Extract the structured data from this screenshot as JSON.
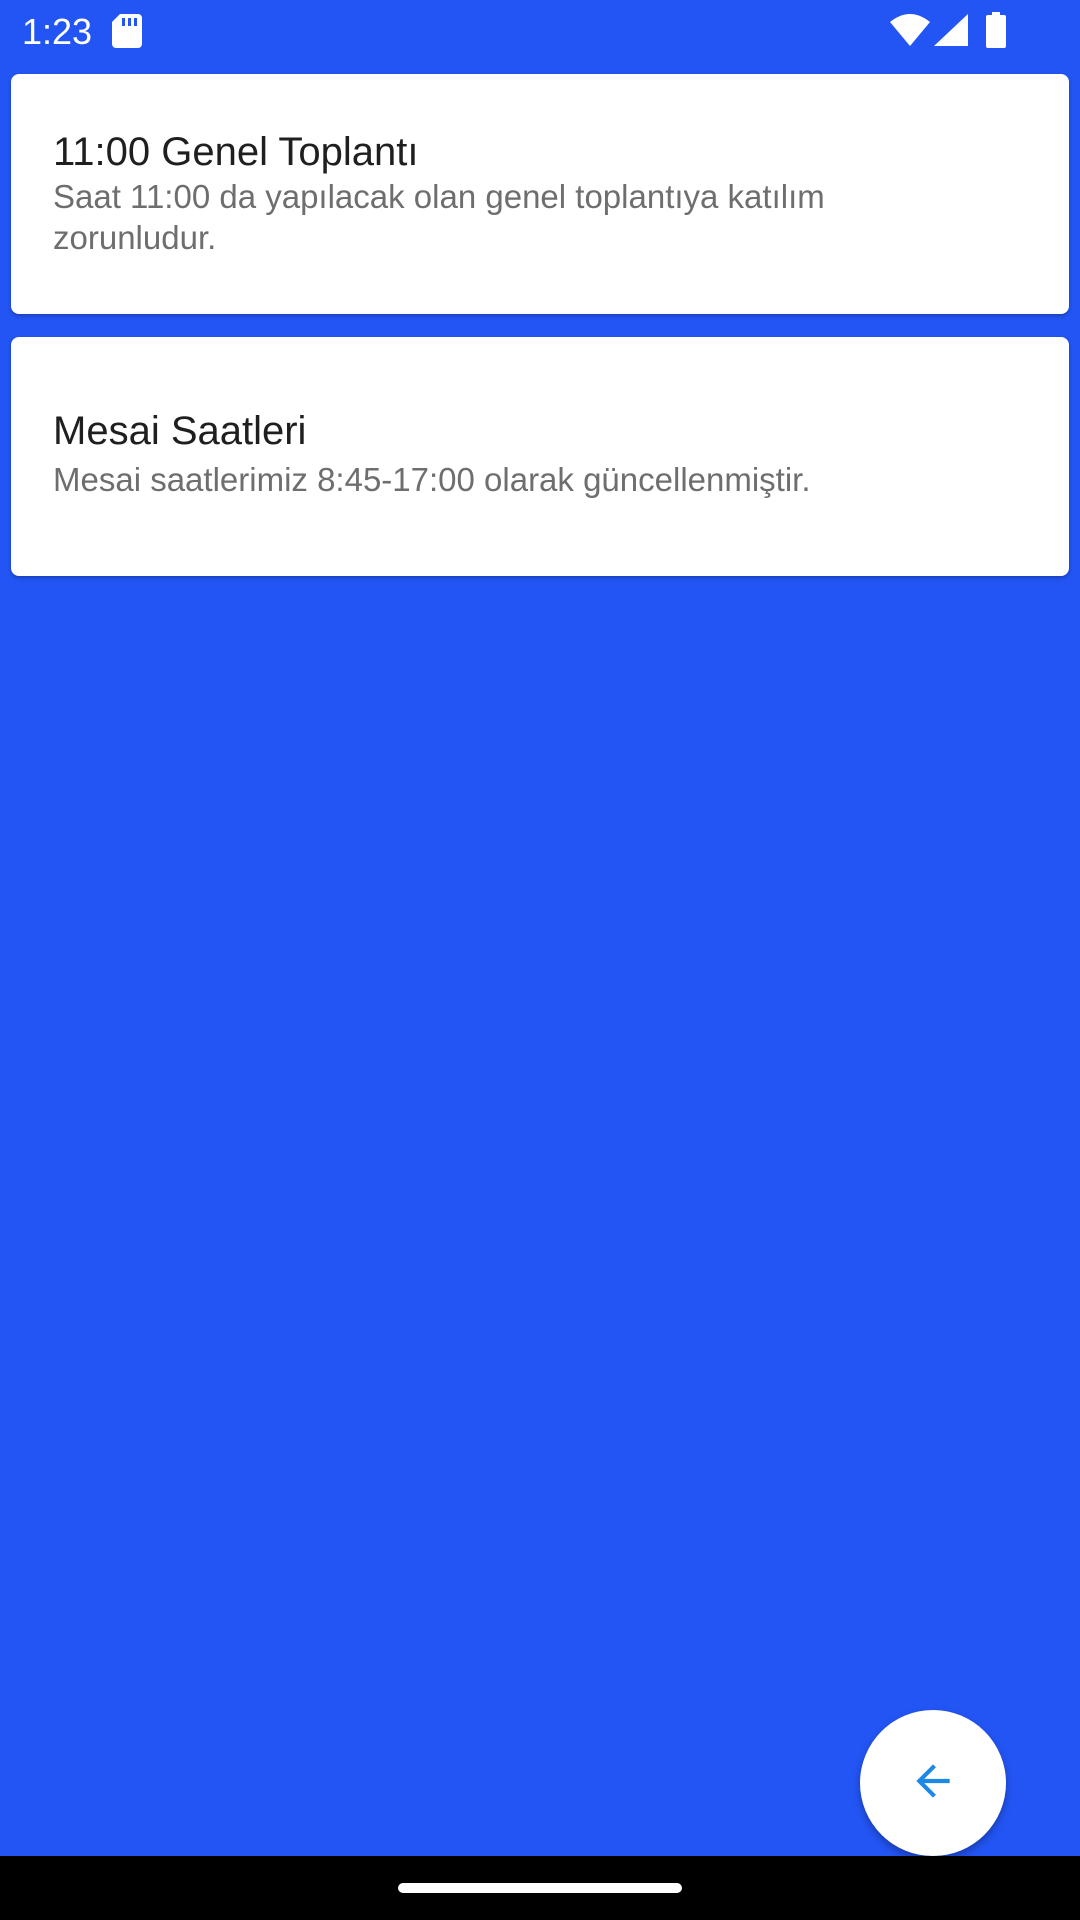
{
  "status_bar": {
    "time": "1:23",
    "icons": [
      "sd-card-icon",
      "wifi-icon",
      "cell-signal-icon",
      "battery-icon"
    ]
  },
  "announcements": [
    {
      "title": "11:00 Genel Toplantı",
      "body": "Saat 11:00 da yapılacak olan genel toplantıya katılım zorunludur."
    },
    {
      "title": "Mesai Saatleri",
      "body": "Mesai saatlerimiz 8:45-17:00 olarak güncellenmiştir."
    }
  ],
  "fab": {
    "icon": "arrow-back-icon"
  },
  "colors": {
    "background": "#2355F5",
    "card": "#FFFFFF",
    "title_text": "#1F1F1F",
    "body_text": "#6E6E6E",
    "fab_icon": "#1E88E5"
  }
}
